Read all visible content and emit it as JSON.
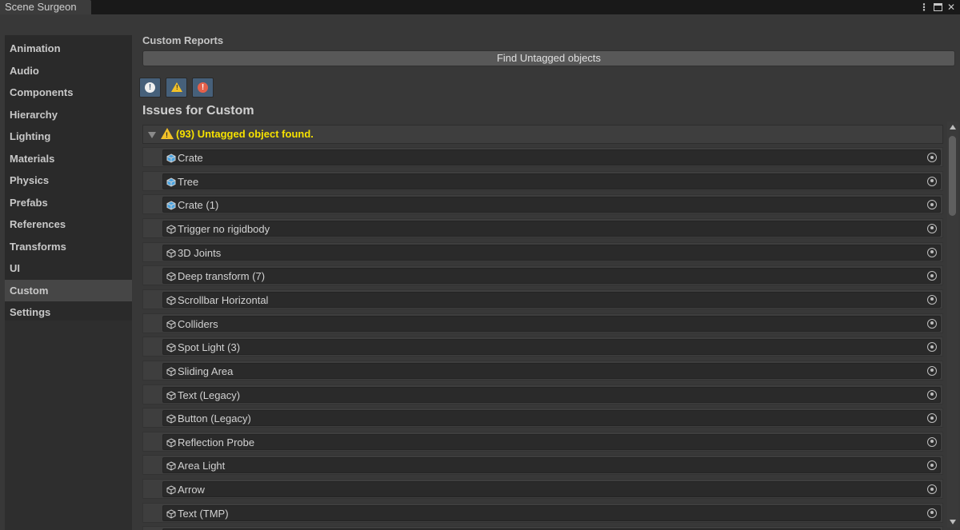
{
  "window": {
    "tab_title": "Scene Surgeon"
  },
  "sidebar": {
    "items": [
      {
        "label": "Animation",
        "active": false
      },
      {
        "label": "Audio",
        "active": false
      },
      {
        "label": "Components",
        "active": false
      },
      {
        "label": "Hierarchy",
        "active": false
      },
      {
        "label": "Lighting",
        "active": false
      },
      {
        "label": "Materials",
        "active": false
      },
      {
        "label": "Physics",
        "active": false
      },
      {
        "label": "Prefabs",
        "active": false
      },
      {
        "label": "References",
        "active": false
      },
      {
        "label": "Transforms",
        "active": false
      },
      {
        "label": "UI",
        "active": false
      },
      {
        "label": "Custom",
        "active": true
      },
      {
        "label": "Settings",
        "active": false
      }
    ]
  },
  "main": {
    "section_label": "Custom Reports",
    "find_button": "Find Untagged objects",
    "filters": [
      "info-filter-icon",
      "warning-filter-icon",
      "error-filter-icon"
    ],
    "issues_title": "Issues for Custom",
    "issue": {
      "severity": "warning",
      "text": "(93) Untagged object found."
    },
    "rows": [
      {
        "label": "Crate",
        "icon": "prefab-icon"
      },
      {
        "label": "Tree",
        "icon": "prefab-icon"
      },
      {
        "label": "Crate (1)",
        "icon": "prefab-icon"
      },
      {
        "label": "Trigger no rigidbody",
        "icon": "gameobject-icon"
      },
      {
        "label": "3D Joints",
        "icon": "gameobject-icon"
      },
      {
        "label": "Deep transform (7)",
        "icon": "gameobject-icon"
      },
      {
        "label": "Scrollbar Horizontal",
        "icon": "gameobject-icon"
      },
      {
        "label": "Colliders",
        "icon": "gameobject-icon"
      },
      {
        "label": "Spot Light (3)",
        "icon": "gameobject-icon"
      },
      {
        "label": "Sliding Area",
        "icon": "gameobject-icon"
      },
      {
        "label": "Text (Legacy)",
        "icon": "gameobject-icon"
      },
      {
        "label": "Button (Legacy)",
        "icon": "gameobject-icon"
      },
      {
        "label": "Reflection Probe",
        "icon": "gameobject-icon"
      },
      {
        "label": "Area Light",
        "icon": "gameobject-icon"
      },
      {
        "label": "Arrow",
        "icon": "gameobject-icon"
      },
      {
        "label": "Text (TMP)",
        "icon": "gameobject-icon"
      },
      {
        "label": "",
        "icon": "gameobject-icon"
      }
    ]
  },
  "colors": {
    "accent_filter": "#46607a",
    "warning": "#f2c128",
    "issue_text": "#f6e100",
    "error": "#e5604a",
    "prefab_blue": "#4aa3e0"
  }
}
